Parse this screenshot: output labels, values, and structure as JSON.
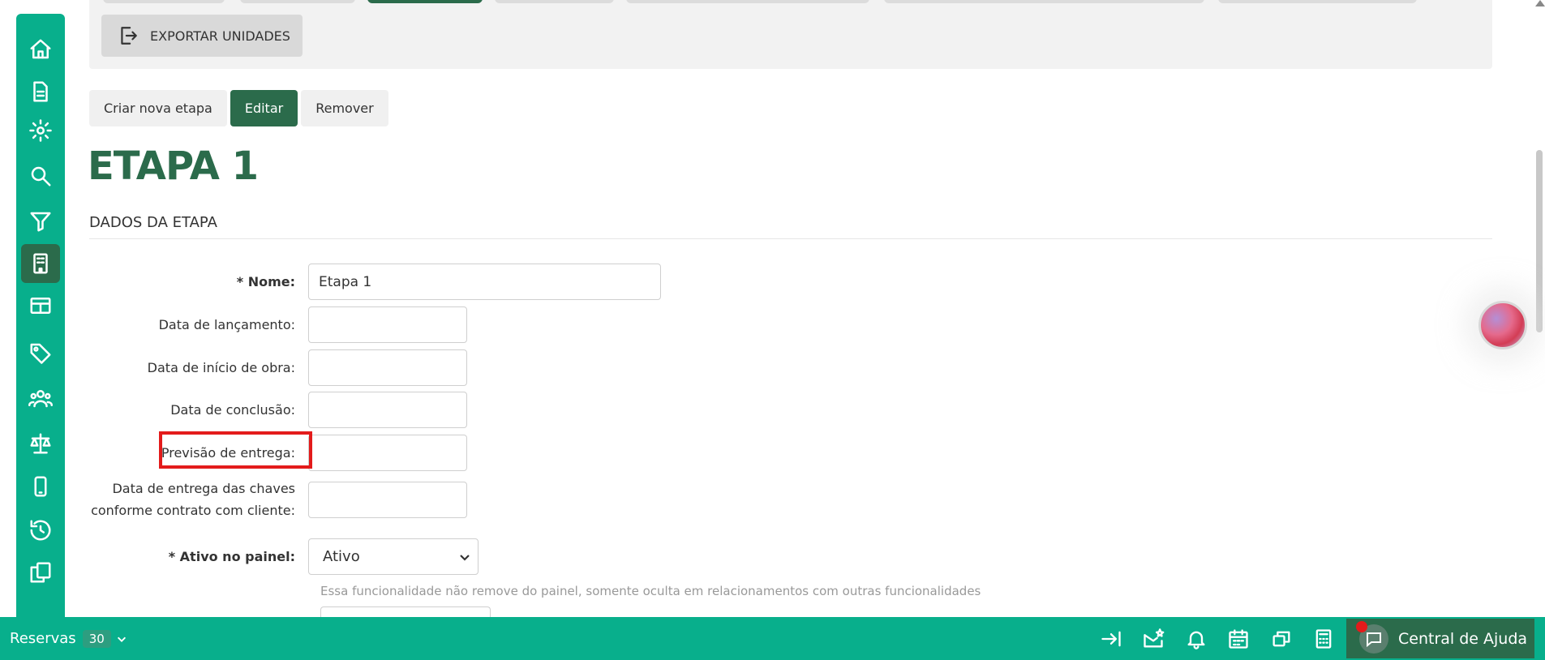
{
  "toolbar": {
    "export_label": "EXPORTAR UNIDADES"
  },
  "actions": {
    "create": "Criar nova etapa",
    "edit": "Editar",
    "remove": "Remover"
  },
  "page": {
    "title": "ETAPA 1",
    "section": "DADOS DA ETAPA"
  },
  "form": {
    "name_label": "* Nome:",
    "name_value": "Etapa 1",
    "launch_label": "Data de lançamento:",
    "start_label": "Data de início de obra:",
    "completion_label": "Data de conclusão:",
    "delivery_forecast_label": "Previsão de entrega:",
    "keys_label_line1": "Data de entrega das chaves",
    "keys_label_line2": "conforme contrato com cliente:",
    "active_label": "* Ativo no painel:",
    "active_value": "Ativo",
    "active_help": "Essa funcionalidade não remove do painel, somente oculta em relacionamentos com outras funcionalidades"
  },
  "bottom_bar": {
    "reservas_label": "Reservas",
    "reservas_count": "30",
    "help_label": "Central de Ajuda"
  },
  "colors": {
    "brand_green": "#08af8c",
    "dark_green": "#2b6b4b",
    "highlight_red": "#e31b1b"
  },
  "sidebar": {
    "items": [
      "home-icon",
      "document-icon",
      "gear-icon",
      "search-icon",
      "filter-icon",
      "building-icon",
      "table-icon",
      "tag-icon",
      "users-icon",
      "scale-icon",
      "mobile-icon",
      "history-icon",
      "copy-icon"
    ],
    "active": "building-icon"
  }
}
